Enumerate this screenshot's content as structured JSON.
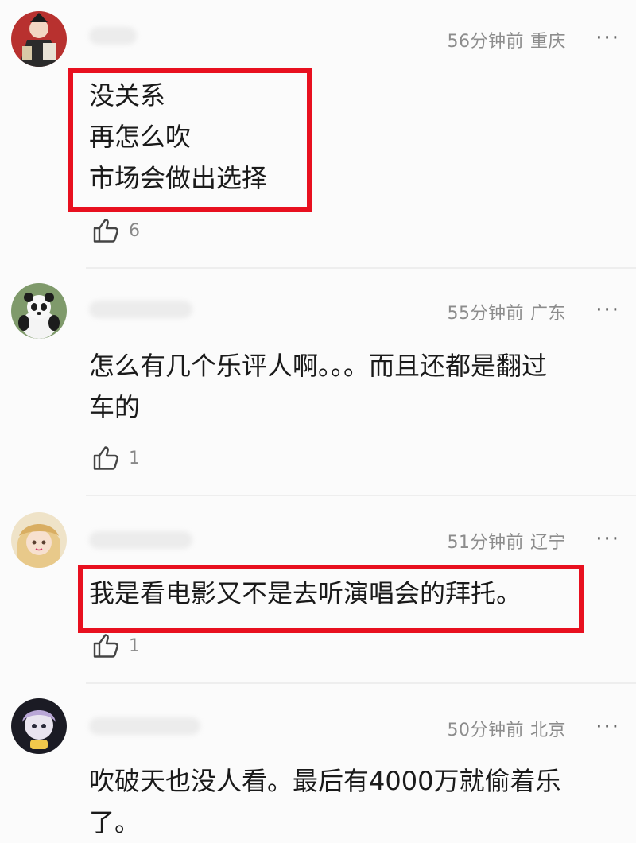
{
  "comments": [
    {
      "time": "56分钟前",
      "location": "重庆",
      "lines": [
        "没关系",
        "再怎么吹",
        "市场会做出选择"
      ],
      "likes": "6"
    },
    {
      "time": "55分钟前",
      "location": "广东",
      "lines": [
        "怎么有几个乐评人啊。。。而且还都是翻过",
        "车的"
      ],
      "likes": "1"
    },
    {
      "time": "51分钟前",
      "location": "辽宁",
      "lines": [
        "我是看电影又不是去听演唱会的拜托。"
      ],
      "likes": "1"
    },
    {
      "time": "50分钟前",
      "location": "北京",
      "lines": [
        "吹破天也没人看。最后有4000万就偷着乐",
        "了。"
      ]
    }
  ],
  "more_label": "···",
  "colors": {
    "highlight": "#e8101f",
    "meta": "#8c8c8c"
  }
}
